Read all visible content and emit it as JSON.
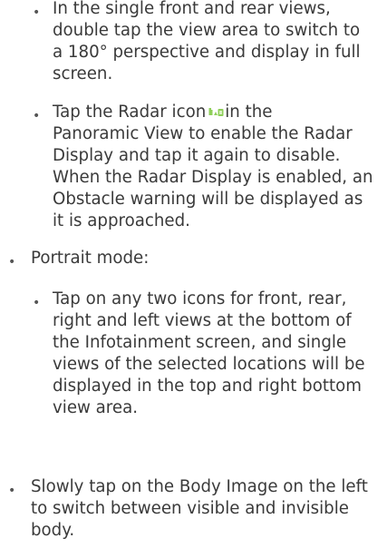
{
  "content": {
    "item1": {
      "bullet": "•",
      "lines": [
        "In the single front and rear views,",
        "double tap the view area to switch to",
        "a 180° perspective and display in full",
        "screen."
      ]
    },
    "item2": {
      "bullet": "•",
      "line1_before_icon": "Tap the Radar icon",
      "icon": "radar-icon",
      "line1_after_icon": "in the",
      "lines": [
        "Panoramic View to enable the Radar",
        "Display and tap it again to disable.",
        "When the Radar Display is enabled, an",
        "Obstacle warning will be displayed as",
        "it is approached."
      ]
    },
    "item3": {
      "bullet": "•",
      "lines": [
        "Portrait  mode:"
      ]
    },
    "item4": {
      "bullet": "•",
      "lines": [
        "Tap on any two icons for front, rear,",
        "right and left views at the bottom of",
        "the Infotainment screen, and single",
        "views of the selected locations will be",
        "displayed in the top and right bottom",
        "view area."
      ]
    },
    "item5": {
      "bullet": "•",
      "lines": [
        "Slowly tap on the Body Image on the left",
        "to switch between visible and invisible",
        "body."
      ]
    }
  },
  "colors": {
    "text": "#3a3a3a",
    "icon": "#8fcf5a"
  }
}
